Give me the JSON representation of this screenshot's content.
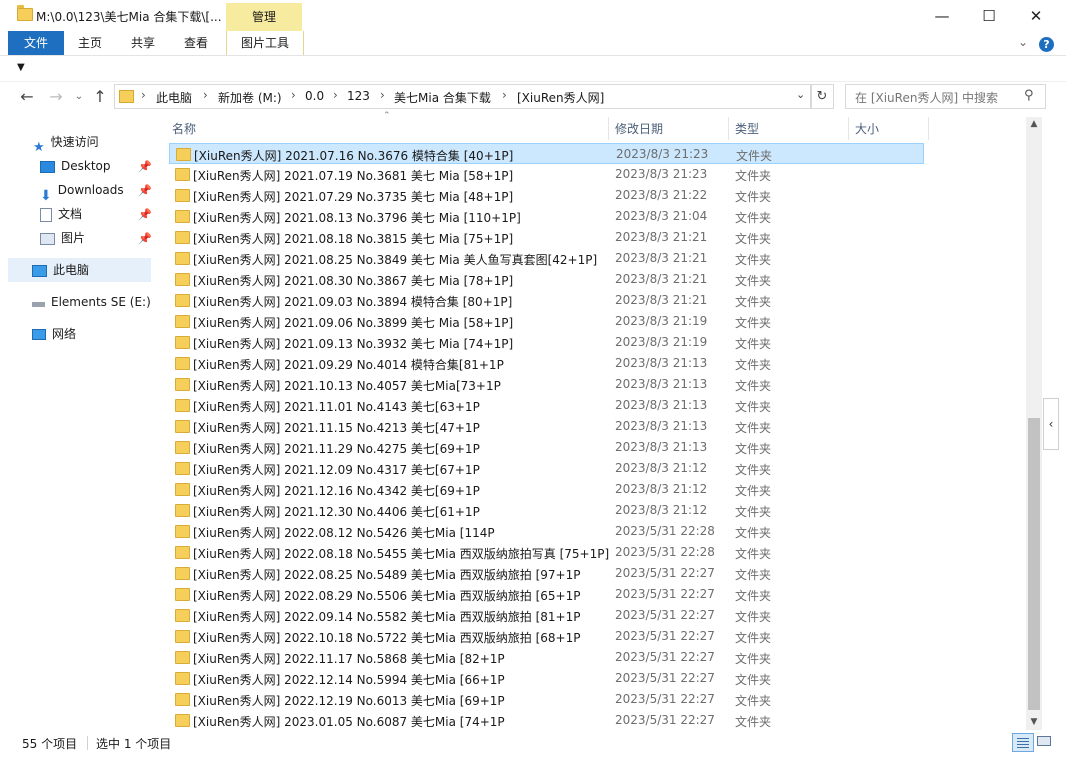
{
  "window": {
    "title": "M:\\0.0\\123\\美七Mia 合集下载\\[...",
    "contextual_tab": "管理"
  },
  "ribbon": {
    "tabs": [
      "文件",
      "主页",
      "共享",
      "查看",
      "图片工具"
    ]
  },
  "address": {
    "crumbs": [
      "此电脑",
      "新加卷 (M:)",
      "0.0",
      "123",
      "美七Mia 合集下载",
      "[XiuRen秀人网]"
    ],
    "search_placeholder": "在 [XiuRen秀人网] 中搜索"
  },
  "nav": {
    "quick_access": "快速访问",
    "items": [
      "Desktop",
      "Downloads",
      "文档",
      "图片"
    ],
    "this_pc": "此电脑",
    "drive": "Elements SE (E:)",
    "network": "网络"
  },
  "columns": {
    "name": "名称",
    "date": "修改日期",
    "type": "类型",
    "size": "大小"
  },
  "files": [
    {
      "name": "[XiuRen秀人网] 2021.07.16 No.3676 模特合集 [40+1P]",
      "date": "2023/8/3 21:23",
      "type": "文件夹",
      "selected": true
    },
    {
      "name": "[XiuRen秀人网] 2021.07.19 No.3681 美七 Mia [58+1P]",
      "date": "2023/8/3 21:23",
      "type": "文件夹"
    },
    {
      "name": "[XiuRen秀人网] 2021.07.29 No.3735 美七 Mia [48+1P]",
      "date": "2023/8/3 21:22",
      "type": "文件夹"
    },
    {
      "name": "[XiuRen秀人网] 2021.08.13 No.3796 美七 Mia [110+1P]",
      "date": "2023/8/3 21:04",
      "type": "文件夹"
    },
    {
      "name": "[XiuRen秀人网] 2021.08.18 No.3815 美七 Mia [75+1P]",
      "date": "2023/8/3 21:21",
      "type": "文件夹"
    },
    {
      "name": "[XiuRen秀人网] 2021.08.25 No.3849 美七 Mia 美人鱼写真套图[42+1P]",
      "date": "2023/8/3 21:21",
      "type": "文件夹"
    },
    {
      "name": "[XiuRen秀人网] 2021.08.30 No.3867 美七 Mia [78+1P]",
      "date": "2023/8/3 21:21",
      "type": "文件夹"
    },
    {
      "name": "[XiuRen秀人网] 2021.09.03 No.3894 模特合集 [80+1P]",
      "date": "2023/8/3 21:21",
      "type": "文件夹"
    },
    {
      "name": "[XiuRen秀人网] 2021.09.06 No.3899 美七 Mia [58+1P]",
      "date": "2023/8/3 21:19",
      "type": "文件夹"
    },
    {
      "name": "[XiuRen秀人网] 2021.09.13 No.3932 美七 Mia [74+1P]",
      "date": "2023/8/3 21:19",
      "type": "文件夹"
    },
    {
      "name": "[XiuRen秀人网] 2021.09.29 No.4014 模特合集[81+1P",
      "date": "2023/8/3 21:13",
      "type": "文件夹"
    },
    {
      "name": "[XiuRen秀人网] 2021.10.13 No.4057 美七Mia[73+1P",
      "date": "2023/8/3 21:13",
      "type": "文件夹"
    },
    {
      "name": "[XiuRen秀人网] 2021.11.01 No.4143 美七[63+1P",
      "date": "2023/8/3 21:13",
      "type": "文件夹"
    },
    {
      "name": "[XiuRen秀人网] 2021.11.15 No.4213 美七[47+1P",
      "date": "2023/8/3 21:13",
      "type": "文件夹"
    },
    {
      "name": "[XiuRen秀人网] 2021.11.29 No.4275 美七[69+1P",
      "date": "2023/8/3 21:13",
      "type": "文件夹"
    },
    {
      "name": "[XiuRen秀人网] 2021.12.09 No.4317 美七[67+1P",
      "date": "2023/8/3 21:12",
      "type": "文件夹"
    },
    {
      "name": "[XiuRen秀人网] 2021.12.16 No.4342 美七[69+1P",
      "date": "2023/8/3 21:12",
      "type": "文件夹"
    },
    {
      "name": "[XiuRen秀人网] 2021.12.30 No.4406 美七[61+1P",
      "date": "2023/8/3 21:12",
      "type": "文件夹"
    },
    {
      "name": "[XiuRen秀人网] 2022.08.12 No.5426 美七Mia [114P",
      "date": "2023/5/31 22:28",
      "type": "文件夹"
    },
    {
      "name": "[XiuRen秀人网] 2022.08.18 No.5455 美七Mia 西双版纳旅拍写真 [75+1P]",
      "date": "2023/5/31 22:28",
      "type": "文件夹"
    },
    {
      "name": "[XiuRen秀人网] 2022.08.25 No.5489 美七Mia 西双版纳旅拍 [97+1P",
      "date": "2023/5/31 22:27",
      "type": "文件夹"
    },
    {
      "name": "[XiuRen秀人网] 2022.08.29 No.5506 美七Mia 西双版纳旅拍 [65+1P",
      "date": "2023/5/31 22:27",
      "type": "文件夹"
    },
    {
      "name": "[XiuRen秀人网] 2022.09.14 No.5582 美七Mia 西双版纳旅拍 [81+1P",
      "date": "2023/5/31 22:27",
      "type": "文件夹"
    },
    {
      "name": "[XiuRen秀人网] 2022.10.18 No.5722 美七Mia 西双版纳旅拍 [68+1P",
      "date": "2023/5/31 22:27",
      "type": "文件夹"
    },
    {
      "name": "[XiuRen秀人网] 2022.11.17 No.5868 美七Mia [82+1P",
      "date": "2023/5/31 22:27",
      "type": "文件夹"
    },
    {
      "name": "[XiuRen秀人网] 2022.12.14 No.5994 美七Mia [66+1P",
      "date": "2023/5/31 22:27",
      "type": "文件夹"
    },
    {
      "name": "[XiuRen秀人网] 2022.12.19 No.6013 美七Mia [69+1P",
      "date": "2023/5/31 22:27",
      "type": "文件夹"
    },
    {
      "name": "[XiuRen秀人网] 2023.01.05 No.6087 美七Mia [74+1P",
      "date": "2023/5/31 22:27",
      "type": "文件夹"
    }
  ],
  "status": {
    "count": "55 个项目",
    "selected": "选中 1 个项目"
  },
  "colors": {
    "accent": "#1f6fc0",
    "selection": "#cce8ff",
    "folder": "#f5cf5a",
    "manage_tab": "#f7eba0"
  }
}
